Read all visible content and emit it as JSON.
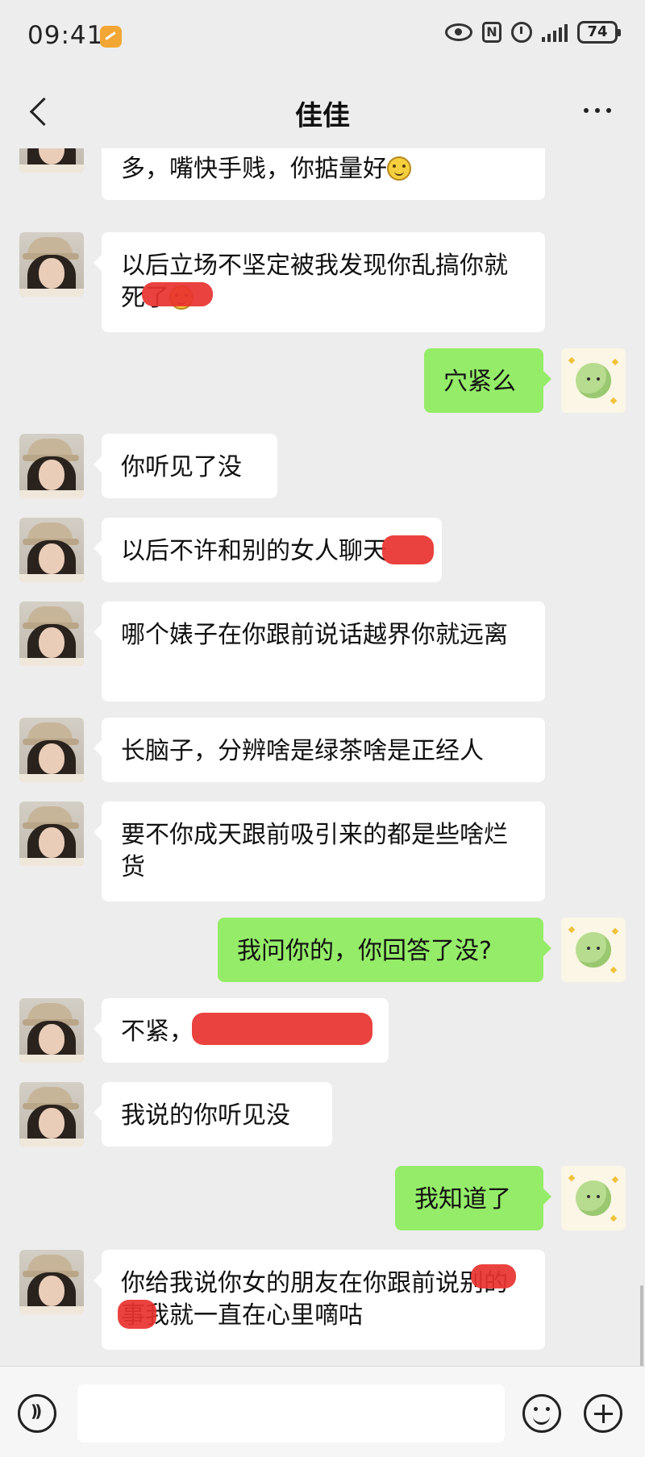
{
  "status": {
    "time": "09:41",
    "battery": "74"
  },
  "header": {
    "title": "佳佳"
  },
  "icons": {
    "back": "back-arrow-icon",
    "more": "more-options-icon",
    "voice": "voice-icon",
    "emoji": "emoji-icon",
    "plus": "plus-icon"
  },
  "colors": {
    "sent_bubble": "#95ec69",
    "received_bubble": "#ffffff",
    "background": "#ededed"
  },
  "messages": [
    {
      "side": "left",
      "text": "我脾气暴，不是善茬，不温柔，毛病多，嘴快手贱，你掂量好",
      "emoji": true
    },
    {
      "side": "left",
      "text": "以后立场不坚定被我发现你乱搞你就死了",
      "emoji": true
    },
    {
      "side": "right",
      "text": "穴紧么"
    },
    {
      "side": "left",
      "text": "你听见了没"
    },
    {
      "side": "left",
      "text": "以后不许和别的女人聊天"
    },
    {
      "side": "left",
      "text": "哪个婊子在你跟前说话越界你就远离"
    },
    {
      "side": "left",
      "text": "长脑子，分辨啥是绿茶啥是正经人"
    },
    {
      "side": "left",
      "text": "要不你成天跟前吸引来的都是些啥烂货"
    },
    {
      "side": "right",
      "text": "我问你的，你回答了没?"
    },
    {
      "side": "left",
      "text": "不紧，"
    },
    {
      "side": "left",
      "text": "我说的你听见没"
    },
    {
      "side": "right",
      "text": "我知道了"
    },
    {
      "side": "left",
      "text": "你给我说你女的朋友在你跟前说别的事我就一直在心里嘀咕"
    }
  ]
}
